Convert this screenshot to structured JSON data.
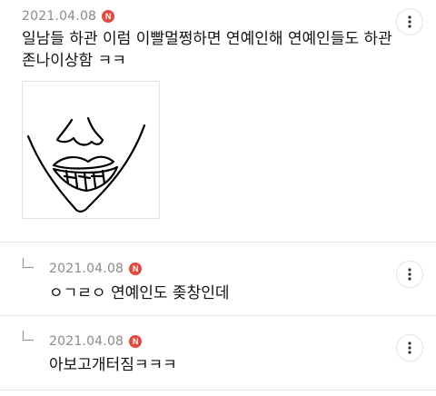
{
  "comments": [
    {
      "date": "2021.04.08",
      "badge": "N",
      "text_line1": "일남들 하관 이럼 이빨멀쩡하면 연예인해 연예인들도 하관",
      "text_line2": "존나이상함 ㅋㅋ",
      "has_image": true,
      "is_reply": false
    },
    {
      "date": "2021.04.08",
      "badge": "N",
      "text": "ㅇㄱㄹㅇ 연예인도 좆창인데",
      "is_reply": true
    },
    {
      "date": "2021.04.08",
      "badge": "N",
      "text": "아보고개터짐ㅋㅋㅋ",
      "is_reply": true
    }
  ],
  "icons": {
    "more": "more-vertical-icon",
    "reply": "reply-arrow-icon",
    "new": "new-badge"
  },
  "colors": {
    "badge": "#e04b41",
    "date": "#8a8a8a",
    "divider": "#e6e6e6"
  }
}
